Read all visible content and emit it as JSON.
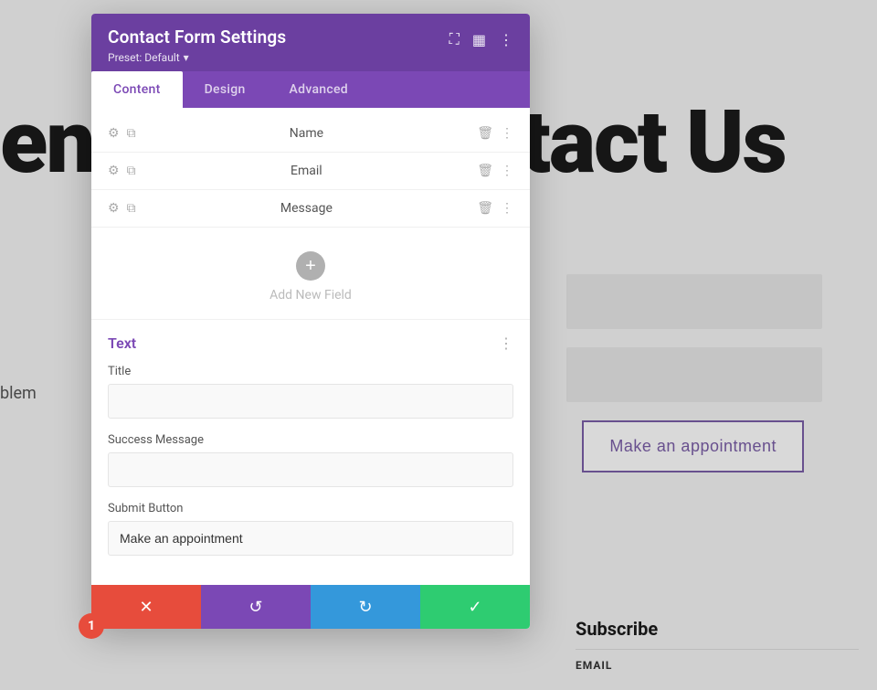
{
  "background": {
    "heading": "tact Us",
    "heading_prefix": "en",
    "problem_text": "blem",
    "appointment_button": "Make an appointment",
    "subscribe_title": "Subscribe",
    "email_label": "EMAIL"
  },
  "modal": {
    "title": "Contact Form Settings",
    "preset_label": "Preset: Default",
    "tabs": [
      {
        "label": "Content",
        "active": true
      },
      {
        "label": "Design",
        "active": false
      },
      {
        "label": "Advanced",
        "active": false
      }
    ],
    "fields": [
      {
        "name": "Name"
      },
      {
        "name": "Email"
      },
      {
        "name": "Message"
      }
    ],
    "add_field_label": "Add New Field",
    "text_section": {
      "title": "Text",
      "title_label": "Title",
      "title_value": "",
      "success_label": "Success Message",
      "success_value": "",
      "submit_label": "Submit Button",
      "submit_value": "Make an appointment"
    },
    "footer": {
      "cancel_label": "✕",
      "undo_label": "↺",
      "redo_label": "↻",
      "save_label": "✓"
    },
    "badge_number": "1"
  }
}
